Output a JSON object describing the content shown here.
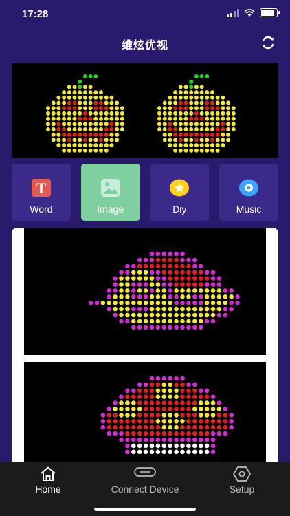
{
  "status_bar": {
    "time": "17:28",
    "icons": [
      "signal-icon",
      "wifi-icon",
      "battery-icon"
    ],
    "battery_level_pct": 90
  },
  "header": {
    "title": "维炫优视",
    "refresh_icon": "refresh-icon"
  },
  "preview": {
    "description": "LED preview banner showing two pumpkins",
    "colors": {
      "stem": "#22d422",
      "body": "#f2ea2c",
      "eyes": "#e01f1f"
    }
  },
  "modes": [
    {
      "label": "Word",
      "icon": "word-icon",
      "active": false
    },
    {
      "label": "Image",
      "icon": "image-icon",
      "active": true
    },
    {
      "label": "Diy",
      "icon": "diy-icon",
      "active": false
    },
    {
      "label": "Music",
      "icon": "music-icon",
      "active": false
    }
  ],
  "gallery": {
    "items": [
      {
        "name": "mushroom-lamp",
        "colors": {
          "a": "#d52bd5",
          "b": "#f2ea2c",
          "c": "#e01f1f"
        }
      },
      {
        "name": "mushroom",
        "colors": {
          "a": "#d52bd5",
          "b": "#e01f1f",
          "c": "#f2ea2c",
          "d": "#ffffff"
        }
      }
    ]
  },
  "tabs": [
    {
      "label": "Home",
      "icon": "home-icon",
      "active": true
    },
    {
      "label": "Connect Device",
      "icon": "device-icon",
      "active": false
    },
    {
      "label": "Setup",
      "icon": "settings-icon",
      "active": false
    }
  ],
  "colors": {
    "background": "#2a1a6e",
    "mode_button": "#3b2a8a",
    "mode_active": "#7fcfa0",
    "tab_active": "#ffffff",
    "tab_inactive": "#bbbbbb"
  }
}
